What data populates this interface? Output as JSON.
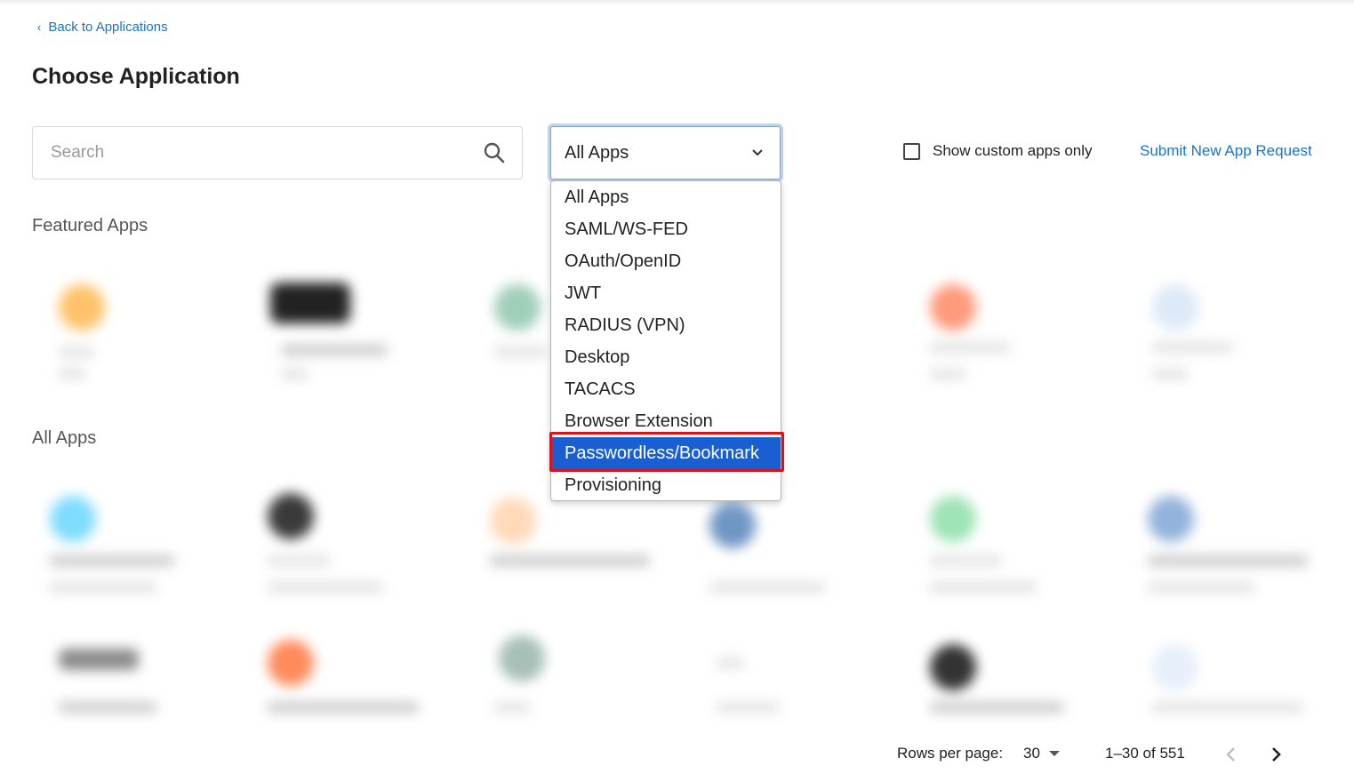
{
  "header": {
    "back_link": "Back to Applications",
    "title": "Choose Application"
  },
  "search": {
    "placeholder": "Search"
  },
  "filter": {
    "selected_value": "All Apps",
    "options": [
      "All Apps",
      "SAML/WS-FED",
      "OAuth/OpenID",
      "JWT",
      "RADIUS (VPN)",
      "Desktop",
      "TACACS",
      "Browser Extension",
      "Passwordless/Bookmark",
      "Provisioning"
    ],
    "highlighted_option": "Passwordless/Bookmark"
  },
  "custom_apps_checkbox": {
    "label": "Show custom apps only",
    "checked": false
  },
  "submit_request": {
    "label": "Submit New App Request"
  },
  "sections": {
    "featured": "Featured Apps",
    "all": "All Apps"
  },
  "pagination": {
    "rows_label": "Rows per page:",
    "rows_value": "30",
    "range": "1–30 of 551"
  },
  "colors": {
    "accent_link": "#1a73c8",
    "selected_option": "#1a5fd1",
    "highlight_border": "#e0101a"
  }
}
